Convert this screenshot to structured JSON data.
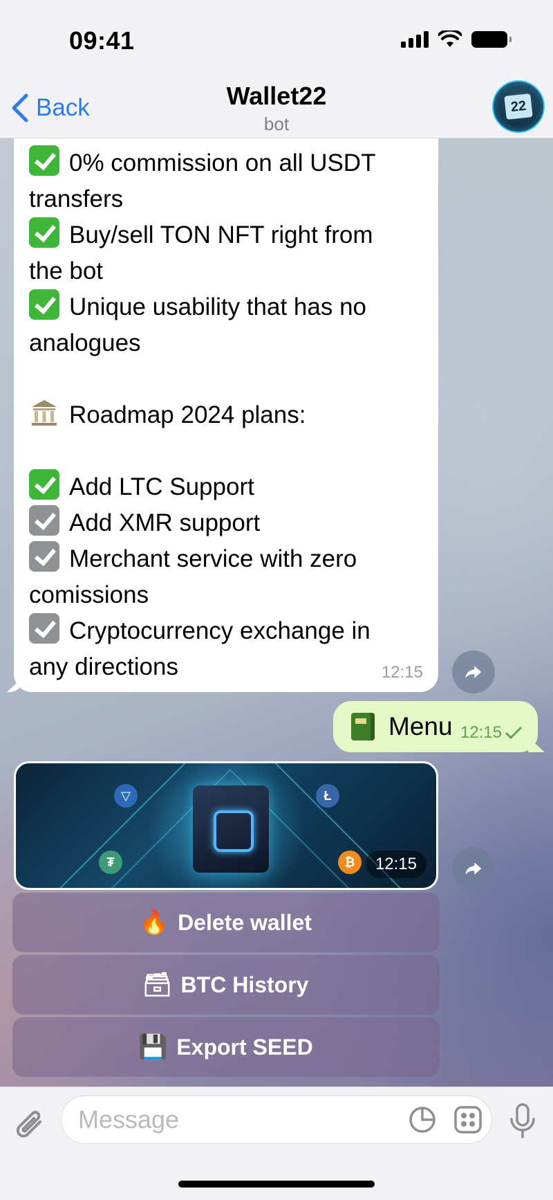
{
  "status_bar": {
    "time": "09:41"
  },
  "header": {
    "back_label": "Back",
    "title": "Wallet22",
    "subtitle": "bot",
    "avatar_text": "22"
  },
  "incoming_message": {
    "lines": [
      {
        "icon": "check-green",
        "text": "0% commission on all USDT"
      },
      {
        "icon": "",
        "text": "transfers"
      },
      {
        "icon": "check-green",
        "text": "Buy/sell TON NFT right from"
      },
      {
        "icon": "",
        "text": "the bot"
      },
      {
        "icon": "check-green",
        "text": "Unique usability that has no"
      },
      {
        "icon": "",
        "text": "analogues"
      },
      {
        "icon": "",
        "text": ""
      },
      {
        "icon": "bank",
        "text": "Roadmap 2024 plans:"
      },
      {
        "icon": "",
        "text": ""
      },
      {
        "icon": "check-green",
        "text": "Add LTC Support"
      },
      {
        "icon": "check-gray",
        "text": "Add XMR support"
      },
      {
        "icon": "check-gray",
        "text": "Merchant service with zero"
      },
      {
        "icon": "",
        "text": "comissions"
      },
      {
        "icon": "check-gray",
        "text": "Cryptocurrency exchange in"
      },
      {
        "icon": "",
        "text": "any directions"
      }
    ],
    "time": "12:15"
  },
  "outgoing_message": {
    "icon": "green-book-icon",
    "text": "Menu",
    "time": "12:15"
  },
  "image_message": {
    "time": "12:15"
  },
  "keyboard_buttons": [
    {
      "icon": "🔥",
      "label": "Delete wallet"
    },
    {
      "icon": "🗃",
      "label": "BTC History"
    },
    {
      "icon": "💾",
      "label": "Export SEED"
    }
  ],
  "composer": {
    "placeholder": "Message"
  },
  "colors": {
    "accent": "#2b7cf0",
    "outgoing_bubble": "#e3f8c6",
    "check_green": "#3fb63a"
  }
}
